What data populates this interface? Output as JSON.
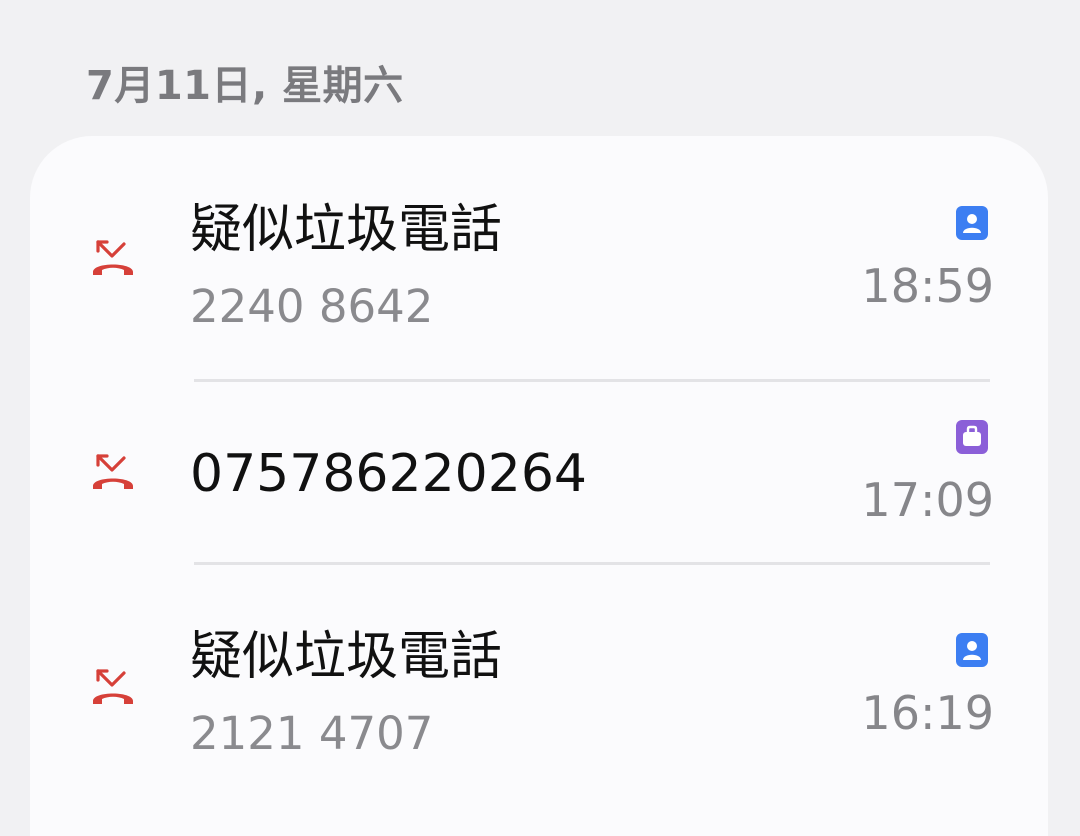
{
  "date_header": "7月11日, 星期六",
  "colors": {
    "background": "#f1f1f3",
    "card": "#fbfbfd",
    "missed_call_red": "#d64039",
    "sim_blue": "#3c7ef2",
    "sim_purple": "#8b5fd8"
  },
  "calls": [
    {
      "name": "疑似垃圾電話",
      "number": "2240 8642",
      "time": "18:59",
      "call_icon": "missed-call-icon",
      "sim_icon": "contact-card-icon",
      "sim_color": "#3c7ef2"
    },
    {
      "name": "075786220264",
      "number": "",
      "time": "17:09",
      "call_icon": "missed-call-icon",
      "sim_icon": "work-briefcase-icon",
      "sim_color": "#8b5fd8"
    },
    {
      "name": "疑似垃圾電話",
      "number": "2121 4707",
      "time": "16:19",
      "call_icon": "missed-call-icon",
      "sim_icon": "contact-card-icon",
      "sim_color": "#3c7ef2"
    }
  ]
}
